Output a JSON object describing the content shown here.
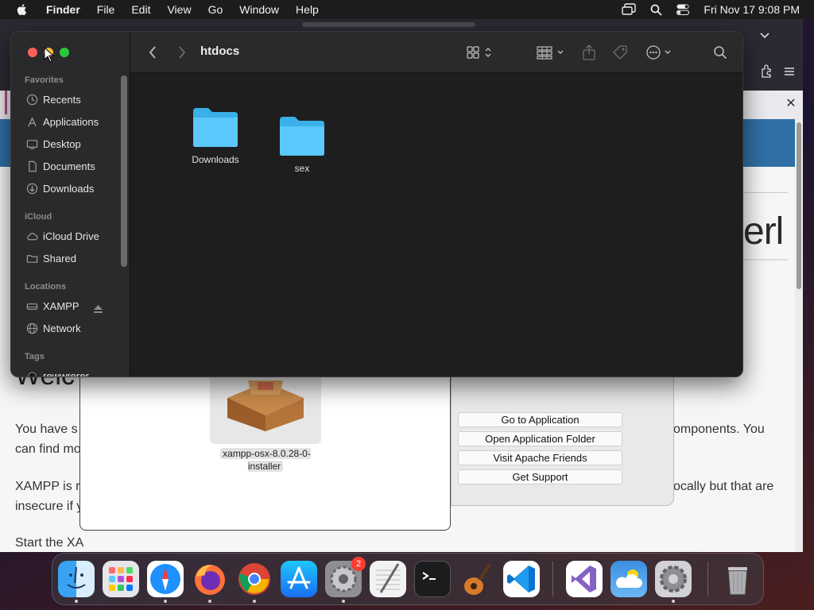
{
  "menubar": {
    "app_name": "Finder",
    "items": [
      "File",
      "Edit",
      "View",
      "Go",
      "Window",
      "Help"
    ],
    "clock": "Fri Nov 17  9:08 PM",
    "icons": [
      "apple-icon",
      "screen-mirroring-icon",
      "spotlight-search-icon",
      "control-center-icon"
    ]
  },
  "browser": {
    "heading_fragment": "erl",
    "welcome_fragment": "Welc",
    "paragraphs": [
      {
        "left": "You have s",
        "right": "omponents. You"
      },
      {
        "left": "can find mo",
        "right": ""
      },
      {
        "left": "XAMPP is r",
        "right": "ocally but that are"
      },
      {
        "left": "insecure if y",
        "right": ""
      },
      {
        "left": "Start the XA",
        "right": ""
      }
    ],
    "notification_close": "✕"
  },
  "installer": {
    "package_label": "xampp-osx-8.0.28-0-installer"
  },
  "xampp_dialog": {
    "buttons": [
      "Go to Application",
      "Open Application Folder",
      "Visit Apache Friends",
      "Get Support"
    ]
  },
  "finder": {
    "title": "htdocs",
    "sections": {
      "favorites": "Favorites",
      "icloud": "iCloud",
      "locations": "Locations",
      "tags": "Tags"
    },
    "favorites": [
      "Recents",
      "Applications",
      "Desktop",
      "Documents",
      "Downloads"
    ],
    "icloud": [
      "iCloud Drive",
      "Shared"
    ],
    "locations": [
      "XAMPP",
      "Network"
    ],
    "tags": [
      "rewwrerer"
    ],
    "folders": [
      "Downloads",
      "sex"
    ],
    "accent": "#5ac8fa"
  },
  "dock": {
    "apps": [
      "Finder",
      "Launchpad",
      "Safari",
      "Firefox",
      "Google Chrome",
      "App Store",
      "System Preferences",
      "TextEdit",
      "Terminal",
      "Instruments",
      "Visual Studio Code",
      "Visual Studio",
      "Weather",
      "Settings",
      "Trash"
    ],
    "badge": "2"
  }
}
